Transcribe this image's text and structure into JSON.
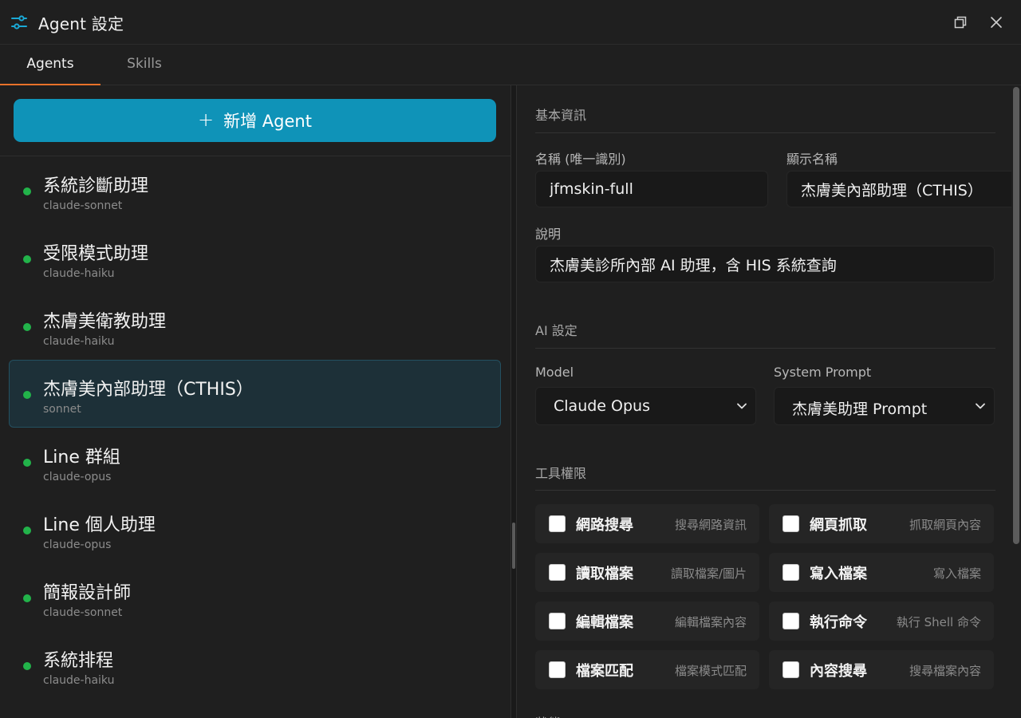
{
  "window": {
    "title": "Agent 設定",
    "icons": {
      "title": "sliders-icon",
      "restore": "window-restore-icon",
      "close": "close-icon"
    }
  },
  "tabs": [
    {
      "label": "Agents",
      "active": true
    },
    {
      "label": "Skills",
      "active": false
    }
  ],
  "left": {
    "add_button": {
      "plus": "+",
      "label": "新增 Agent"
    },
    "agents": [
      {
        "name": "系統診斷助理",
        "model": "claude-sonnet",
        "selected": false
      },
      {
        "name": "受限模式助理",
        "model": "claude-haiku",
        "selected": false
      },
      {
        "name": "杰膚美衛教助理",
        "model": "claude-haiku",
        "selected": false
      },
      {
        "name": "杰膚美內部助理（CTHIS）",
        "model": "sonnet",
        "selected": true
      },
      {
        "name": "Line 群組",
        "model": "claude-opus",
        "selected": false
      },
      {
        "name": "Line 個人助理",
        "model": "claude-opus",
        "selected": false
      },
      {
        "name": "簡報設計師",
        "model": "claude-sonnet",
        "selected": false
      },
      {
        "name": "系統排程",
        "model": "claude-haiku",
        "selected": false
      }
    ],
    "status_color": "#22b34a"
  },
  "right": {
    "basic": {
      "title": "基本資訊",
      "name_label": "名稱 (唯一識別)",
      "name_value": "jfmskin-full",
      "display_label": "顯示名稱",
      "display_value": "杰膚美內部助理（CTHIS）",
      "desc_label": "說明",
      "desc_value": "杰膚美診所內部 AI 助理，含 HIS 系統查詢"
    },
    "ai": {
      "title": "AI 設定",
      "model_label": "Model",
      "model_value": "Claude Opus",
      "prompt_label": "System Prompt",
      "prompt_value": "杰膚美助理 Prompt"
    },
    "tools": {
      "title": "工具權限",
      "items": [
        {
          "name": "網路搜尋",
          "desc": "搜尋網路資訊",
          "checked": false
        },
        {
          "name": "網頁抓取",
          "desc": "抓取網頁內容",
          "checked": false
        },
        {
          "name": "讀取檔案",
          "desc": "讀取檔案/圖片",
          "checked": false
        },
        {
          "name": "寫入檔案",
          "desc": "寫入檔案",
          "checked": false
        },
        {
          "name": "編輯檔案",
          "desc": "編輯檔案內容",
          "checked": false
        },
        {
          "name": "執行命令",
          "desc": "執行 Shell 命令",
          "checked": false
        },
        {
          "name": "檔案匹配",
          "desc": "檔案模式匹配",
          "checked": false
        },
        {
          "name": "內容搜尋",
          "desc": "搜尋檔案內容",
          "checked": false
        }
      ]
    }
  },
  "colors": {
    "accent": "#0f93b8",
    "tab_indicator": "#e8722a",
    "background": "#1f1f1f"
  }
}
